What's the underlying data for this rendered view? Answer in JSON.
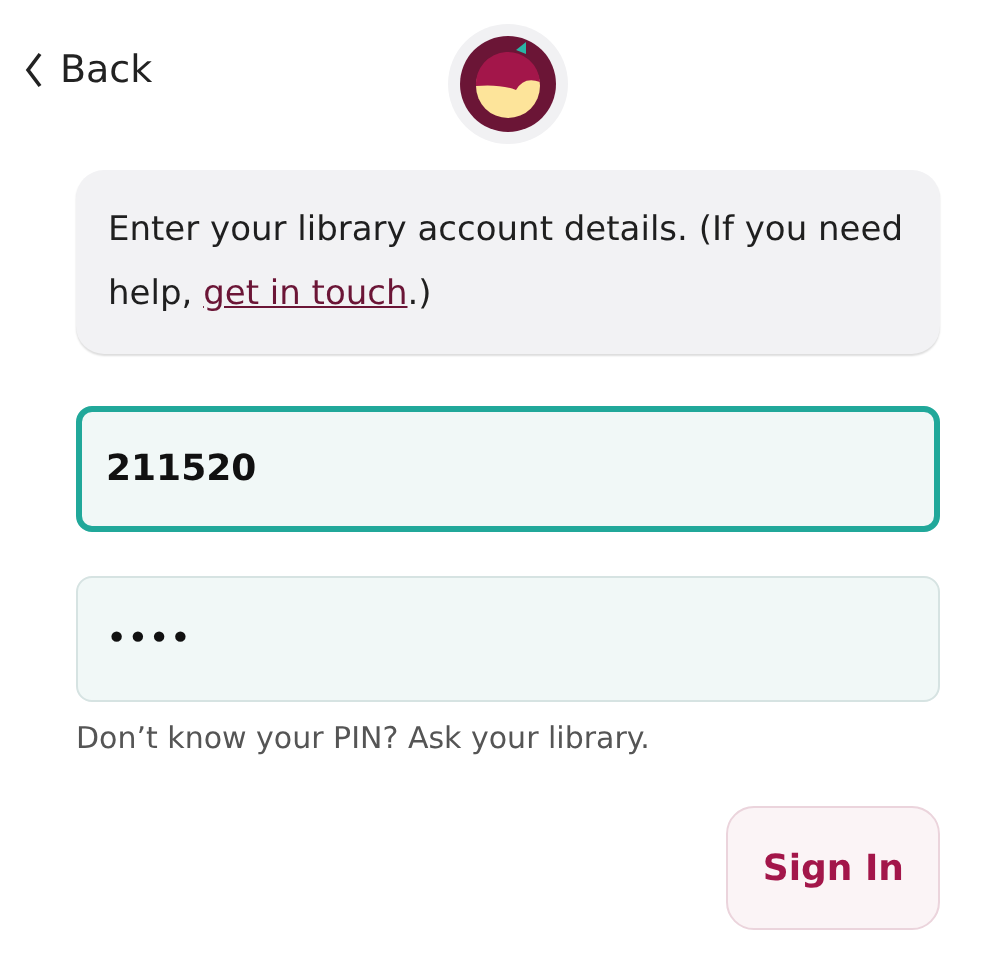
{
  "header": {
    "back_label": "Back"
  },
  "message": {
    "before": "Enter your library account details. (If you need help, ",
    "link": "get in touch",
    "after": ".)"
  },
  "fields": [
    {
      "kind": "text",
      "value": "211520",
      "focused": true
    },
    {
      "kind": "secret",
      "value": "••••",
      "focused": false
    }
  ],
  "hint": "Don’t know your PIN? Ask your library.",
  "buttons": [
    {
      "label": "Sign In"
    }
  ]
}
